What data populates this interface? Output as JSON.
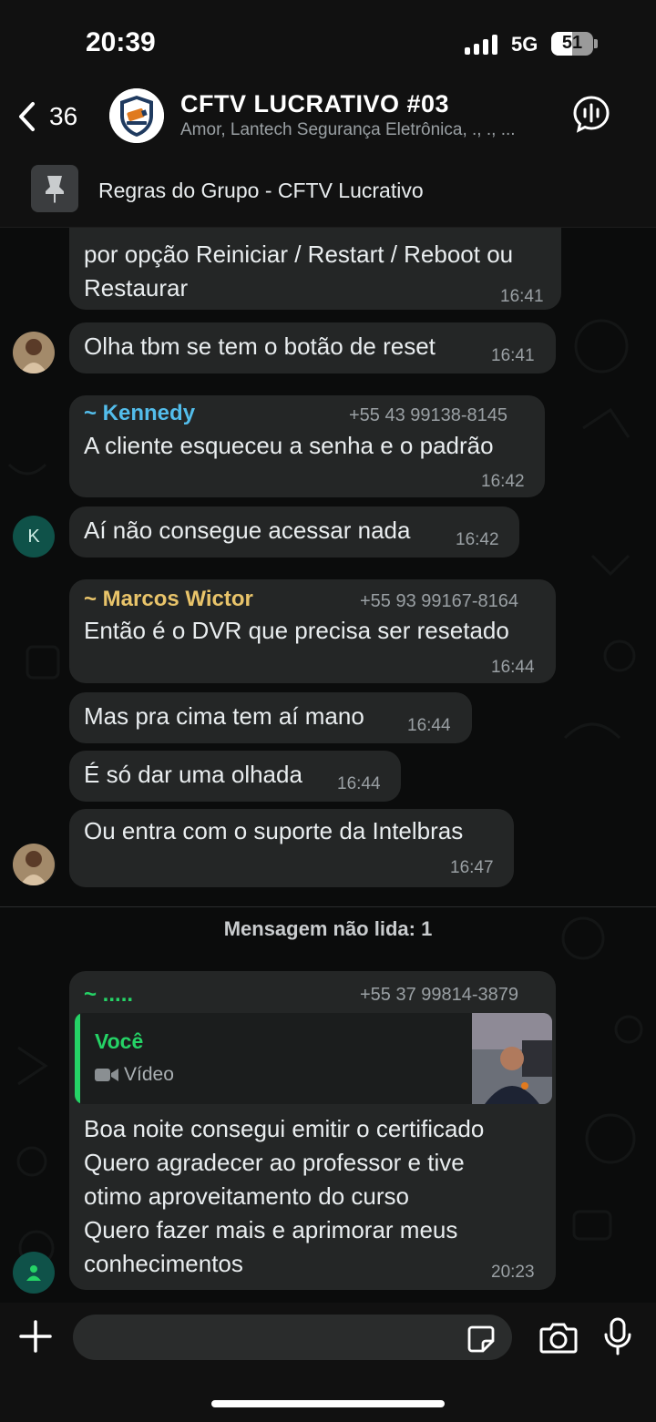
{
  "status_bar": {
    "time": "20:39",
    "network": "5G",
    "battery": "51",
    "battery_level": 0.51
  },
  "header": {
    "back_count": "36",
    "title": "CFTV LUCRATIVO #03",
    "subtitle": "Amor, Lantech Segurança Eletrônica, ., ., ..."
  },
  "pinned": {
    "text": "Regras do Grupo - CFTV Lucrativo"
  },
  "messages": [
    {
      "text": "por opção Reiniciar / Restart / Reboot ou\nRestaurar",
      "time": "16:41"
    },
    {
      "text": "Olha tbm se tem o botão de reset",
      "time": "16:41"
    },
    {
      "sender": "~ Kennedy",
      "phone": "+55 43 99138-8145",
      "text": "A cliente esqueceu a senha e o padrão",
      "time": "16:42",
      "avatar_letter": "K"
    },
    {
      "text": "Aí não consegue acessar nada",
      "time": "16:42"
    },
    {
      "sender": "~ Marcos Wictor",
      "phone": "+55 93 99167-8164",
      "text": "Então é o DVR que precisa ser resetado",
      "time": "16:44"
    },
    {
      "text": "Mas pra cima tem aí mano",
      "time": "16:44"
    },
    {
      "text": "É só dar uma olhada",
      "time": "16:44"
    },
    {
      "text": "Ou entra com o suporte da Intelbras",
      "time": "16:47"
    },
    {
      "sender": "~ .....",
      "phone": "+55 37 99814-3879",
      "quote_author": "Você",
      "quote_type": "Vídeo",
      "text": "Boa noite consegui emitir o certificado\nQuero agradecer ao professor e tive\notimo aproveitamento do curso\nQuero fazer mais e aprimorar meus\nconhecimentos",
      "time": "20:23"
    }
  ],
  "unread_label": "Mensagem não lida: 1",
  "colors": {
    "kennedy": "#53bdeb",
    "marcos": "#e9c46a",
    "green": "#25d366",
    "bubble": "#242626"
  }
}
